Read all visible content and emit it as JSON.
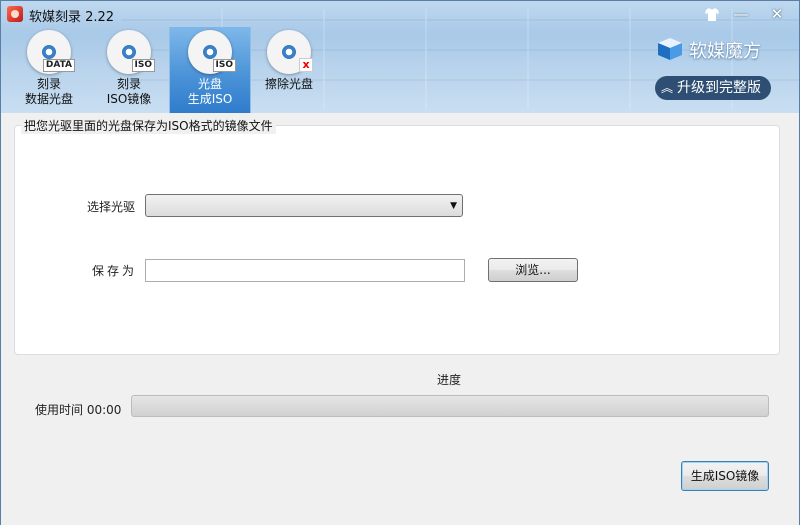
{
  "window": {
    "title": "软媒刻录 2.22"
  },
  "controls": {
    "skin": "shirt-icon",
    "minimize": "—",
    "close": "✕"
  },
  "tabs": [
    {
      "line1": "刻录",
      "line2": "数据光盘",
      "tag": "DATA",
      "active": false
    },
    {
      "line1": "刻录",
      "line2": "ISO镜像",
      "tag": "ISO",
      "active": false
    },
    {
      "line1": "光盘",
      "line2": "生成ISO",
      "tag": "ISO",
      "active": true
    },
    {
      "line1": "擦除光盘",
      "line2": "",
      "tag": "x",
      "active": false
    }
  ],
  "brand": {
    "name": "软媒魔方",
    "upgrade": "升级到完整版",
    "upgrade_icon": "︽"
  },
  "group": {
    "caption": "把您光驱里面的光盘保存为ISO格式的镜像文件"
  },
  "drive": {
    "label": "选择光驱",
    "selected": ""
  },
  "save": {
    "label": "保存为",
    "value": "",
    "browse": "浏览..."
  },
  "progress": {
    "title": "进度",
    "elapsed_label": "使用时间",
    "elapsed": "00:00",
    "percent": 0
  },
  "actions": {
    "generate": "生成ISO镜像"
  },
  "colors": {
    "active_tab": "#4c94d8",
    "header": "#b8d3ec",
    "upgrade_bg": "#2e4f73"
  }
}
